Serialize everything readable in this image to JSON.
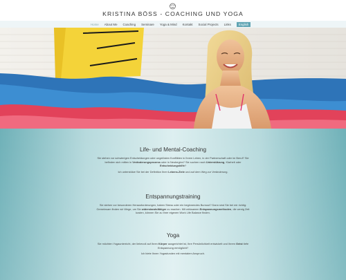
{
  "header": {
    "title": "KRISTINA BÖSS - COACHING UND YOGA",
    "logo_icon": "smiley-logo-icon"
  },
  "nav": {
    "items": [
      {
        "label": "Home"
      },
      {
        "label": "About Me"
      },
      {
        "label": "Coaching"
      },
      {
        "label": "Seminare"
      },
      {
        "label": "Yoga & Mind"
      },
      {
        "label": "Kontakt"
      },
      {
        "label": "Social Projects"
      },
      {
        "label": "Links"
      }
    ],
    "language": "English"
  },
  "colors": {
    "accent": "#5fa4b3",
    "teal_background": "#6fb1b8"
  },
  "sections": [
    {
      "title": "Life- und Mental-Coaching",
      "p1_a": "Sie stehen vor schwierigen Entscheidungen oder ungelösten Konflikten in Ihrem Leben, in der Partnerschaft oder im Beruf? Sie befinden sich mitten in ",
      "p1_b": "Veränderungsprozess",
      "p1_c": " oder in Neubeginn? Sie suchen nach ",
      "p1_d": "Unterstützung",
      "p1_e": ", Klarheit oder ",
      "p1_f": "Entscheidungshilfe",
      "p1_g": "?",
      "p2_a": "Ich unterstütze Sie bei der Definition Ihrer ",
      "p2_b": "Lebens-Ziele",
      "p2_c": " und auf dem Weg zur Veränderung."
    },
    {
      "title": "Entspannungstraining",
      "p1_a": "Sie stehen vor besonderen Herausforderungen, haben Stress oder ein beginnendes Burnout? Dann sind Sie bei mir richtig: Gemeinsam finden wir Wege, um Sie ",
      "p1_b": "widerstandsfähiger",
      "p1_c": " zu machen. Mit wirksamen ",
      "p1_d": "Entspannungsmethoden",
      "p1_e": ", die wenig Zeit kosten, können Sie zu Ihrer eigenen Work Life Balance finden."
    },
    {
      "title": "Yoga",
      "p1_a": "Sie möchten Yogaunterricht, der liebevoll auf Ihren ",
      "p1_b": "Körper",
      "p1_c": " ausgerichtet ist, Ihre Persönlichkeit entwickelt und Ihrem ",
      "p1_d": "Geist",
      "p1_e": " tiefe Entspannung ermöglicht?",
      "p2": "Ich biete Ihnen Yogastunden mit mentalem Anspruch."
    }
  ]
}
